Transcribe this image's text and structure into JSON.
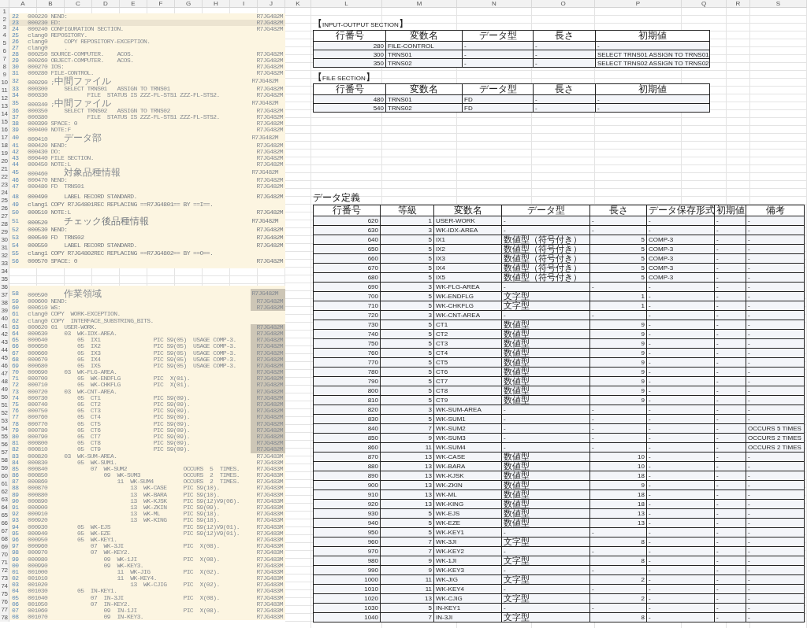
{
  "sheet": {
    "left_columns": [
      "A",
      "B",
      "C",
      "D",
      "E",
      "F",
      "G",
      "H",
      "I",
      "J"
    ],
    "right_columns": [
      "K",
      "L",
      "M",
      "N",
      "O",
      "P",
      "Q",
      "R",
      "S"
    ],
    "row_numbers": [
      "1",
      "2",
      "3",
      "4",
      "5",
      "6",
      "7",
      "8",
      "9",
      "10",
      "11",
      "12",
      "13",
      "14",
      "15",
      "16",
      "17",
      "18",
      "19",
      "20",
      "21",
      "22",
      "23",
      "24",
      "25",
      "26",
      "27",
      "28",
      "29",
      "30",
      "31",
      "32",
      "33",
      "34",
      "35",
      "36",
      "37",
      "38",
      "39",
      "40",
      "41",
      "42",
      "43",
      "44",
      "45",
      "46",
      "47",
      "48",
      "49",
      "50",
      "51",
      "52",
      "53",
      "54",
      "55",
      "56",
      "57",
      "58",
      "59",
      "60",
      "61",
      "62",
      "63",
      "64",
      "65",
      "66",
      "67",
      "68",
      "69",
      "70",
      "71",
      "72",
      "73",
      "74",
      "75",
      "76",
      "77",
      "78"
    ]
  },
  "code_top": [
    {
      "num": "22",
      "code": "000220 NEND:",
      "id": "R7JG482M",
      "kind": "code",
      "highlighted": false
    },
    {
      "num": "23",
      "code": "000230 ED:",
      "id": "R7JG482M",
      "kind": "code",
      "highlighted": true
    },
    {
      "num": "24",
      "code": "000240 CONFIGURATION SECTION.",
      "id": "R7JG482M",
      "kind": "code",
      "highlighted": false
    },
    {
      "num": "25",
      "code": "clang0 REPOSITORY.",
      "kind": "code",
      "highlighted": false
    },
    {
      "num": "26",
      "code": "clang0     COPY REPOSITORY-EXCEPTION.",
      "kind": "code",
      "highlighted": false
    },
    {
      "num": "27",
      "code": "clang0     .",
      "kind": "code",
      "highlighted": false
    },
    {
      "num": "28",
      "code": "000250 SOURCE-COMPUTER.    ACOS.",
      "id": "R7JG482M",
      "kind": "code",
      "highlighted": false
    },
    {
      "num": "29",
      "code": "000260 OBJECT-COMPUTER.    ACOS.",
      "id": "R7JG482M",
      "kind": "code",
      "highlighted": false
    },
    {
      "num": "30",
      "code": "000270 IOS:",
      "id": "R7JG482M",
      "kind": "code",
      "highlighted": false
    },
    {
      "num": "31",
      "code": "000280 FILE-CONTROL.",
      "id": "R7JG482M",
      "kind": "code",
      "highlighted": false
    },
    {
      "num": "32",
      "code": "000290 ;中間ファイル",
      "id": "R7JG482M",
      "kind": "note",
      "highlighted": false
    },
    {
      "num": "33",
      "code": "000300     SELECT TRNS01   ASSIGN TO TRNS01",
      "id": "R7JG482M",
      "kind": "code",
      "highlighted": false
    },
    {
      "num": "34",
      "code": "000330            FILE  STATUS IS ZZZ-FL-STS1 ZZZ-FL-STS2.",
      "id": "R7JG482M",
      "kind": "code",
      "highlighted": false
    },
    {
      "num": "35",
      "code": "000340 ;中間ファイル",
      "id": "R7JG482M",
      "kind": "note",
      "highlighted": false
    },
    {
      "num": "36",
      "code": "000350     SELECT TRNS02   ASSIGN TO TRNS02",
      "id": "R7JG482M",
      "kind": "code",
      "highlighted": false
    },
    {
      "num": "37",
      "code": "000380            FILE  STATUS IS ZZZ-FL-STS1 ZZZ-FL-STS2.",
      "id": "R7JG482M",
      "kind": "code",
      "highlighted": false
    },
    {
      "num": "38",
      "code": "000390 SPACE: 0",
      "id": "R7JG482M",
      "kind": "code",
      "highlighted": false
    },
    {
      "num": "39",
      "code": "000400 NOTE:F",
      "id": "R7JG482M",
      "kind": "code",
      "highlighted": false
    },
    {
      "num": "40",
      "code": "000410     データ部",
      "id": "R7JG482M",
      "kind": "note",
      "highlighted": false
    },
    {
      "num": "41",
      "code": "000420 NEND:",
      "id": "R7JG482M",
      "kind": "code",
      "highlighted": false
    },
    {
      "num": "42",
      "code": "000430 DO:",
      "id": "R7JG482M",
      "kind": "code",
      "highlighted": false
    },
    {
      "num": "43",
      "code": "000440 FILE SECTION.",
      "id": "R7JG482M",
      "kind": "code",
      "highlighted": false
    },
    {
      "num": "44",
      "code": "000450 NOTE:L",
      "id": "R7JG482M",
      "kind": "code",
      "highlighted": false
    },
    {
      "num": "45",
      "code": "000460     対象品種情報",
      "id": "R7JG482M",
      "kind": "note",
      "highlighted": false
    },
    {
      "num": "46",
      "code": "000470 NEND:",
      "id": "R7JG482M",
      "kind": "code",
      "highlighted": false
    },
    {
      "num": "47",
      "code": "000480 FD  TRNS01",
      "id": "R7JG482M",
      "kind": "code",
      "highlighted": false
    }
  ],
  "code_middle": [
    {
      "num": "48",
      "code": "000490     LABEL RECORD STANDARD.",
      "id": "R7JG482M",
      "kind": "code"
    },
    {
      "num": "49",
      "code": "clang1 COPY R7JG4801REC REPLACING ==R7JG4801== BY ==I==.",
      "kind": "code"
    },
    {
      "num": "50",
      "code": "000510 NOTE:L",
      "id": "R7JG482M",
      "kind": "code"
    },
    {
      "num": "51",
      "code": "000520     チェック後品種情報",
      "id": "R7JG482M",
      "kind": "note"
    },
    {
      "num": "52",
      "code": "000530 NEND:",
      "id": "R7JG482M",
      "kind": "code"
    },
    {
      "num": "53",
      "code": "000540 FD  TRNS02",
      "id": "R7JG482M",
      "kind": "code"
    },
    {
      "num": "54",
      "code": "000550     LABEL RECORD STANDARD.",
      "id": "R7JG482M",
      "kind": "code"
    },
    {
      "num": "55",
      "code": "clang1 COPY R7JG4802REC REPLACING ==R7JG4802== BY ==O==.",
      "kind": "code"
    },
    {
      "num": "56",
      "code": "000570 SPACE: 0",
      "id": "R7JG482M",
      "kind": "code"
    }
  ],
  "code_bottom": [
    {
      "num": "58",
      "code": "000590     作業領域",
      "id": "R7JG482M",
      "kind": "note",
      "id_selected": true
    },
    {
      "num": "59",
      "code": "000600 NEND:",
      "id": "R7JG482M",
      "kind": "code",
      "id_selected": true
    },
    {
      "num": "60",
      "code": "000610 WS:",
      "id": "R7JG482M",
      "kind": "code",
      "id_selected": true
    },
    {
      "num": "61",
      "code": "clang0 COPY  WORK-EXCEPTION.",
      "kind": "code"
    },
    {
      "num": "62",
      "code": "clang0 COPY  INTERFACE_SUBSTRING_BITS.",
      "kind": "code"
    },
    {
      "num": "63",
      "code": "000620 01  USER-WORK.",
      "id": "R7JG482M",
      "kind": "code",
      "id_selected": true
    },
    {
      "num": "64",
      "code": "000630     03  WK-IDX-AREA.",
      "id": "R7JG482M",
      "kind": "code",
      "id_selected": true
    },
    {
      "num": "65",
      "code": "000640         05  IX1                PIC S9(05)  USAGE COMP-3.",
      "id": "R7JG482M",
      "kind": "code",
      "id_selected": true
    },
    {
      "num": "66",
      "code": "000650         05  IX2                PIC S9(05)  USAGE COMP-3.",
      "id": "R7JG482M",
      "kind": "code",
      "id_selected": true
    },
    {
      "num": "67",
      "code": "000660         05  IX3                PIC S9(05)  USAGE COMP-3.",
      "id": "R7JG482M",
      "kind": "code",
      "id_selected": true
    },
    {
      "num": "68",
      "code": "000670         05  IX4                PIC S9(05)  USAGE COMP-3.",
      "id": "R7JG482M",
      "kind": "code",
      "id_selected": true
    },
    {
      "num": "69",
      "code": "000680         05  IX5                PIC S9(05)  USAGE COMP-3.",
      "id": "R7JG482M",
      "kind": "code",
      "id_selected": true
    },
    {
      "num": "70",
      "code": "000690     03  WK-FLG-AREA.",
      "id": "R7JG482M",
      "kind": "code",
      "id_selected": true
    },
    {
      "num": "71",
      "code": "000700         05  WK-ENDFLG          PIC  X(01).",
      "id": "R7JG482M",
      "kind": "code",
      "id_selected": true
    },
    {
      "num": "72",
      "code": "000710         05  WK-CHKFLG          PIC  X(01).",
      "id": "R7JG482M",
      "kind": "code",
      "id_selected": true
    },
    {
      "num": "73",
      "code": "000720     03  WK-CNT-AREA.",
      "id": "R7JG482M",
      "kind": "code",
      "id_selected": true
    },
    {
      "num": "74",
      "code": "000730         05  CT1                PIC S9(09).",
      "id": "R7JG482M",
      "kind": "code",
      "id_selected": true
    },
    {
      "num": "75",
      "code": "000740         05  CT2                PIC S9(09).",
      "id": "R7JG482M",
      "kind": "code",
      "id_selected": true
    },
    {
      "num": "76",
      "code": "000750         05  CT3                PIC S9(09).",
      "id": "R7JG482M",
      "kind": "code",
      "id_selected": true
    },
    {
      "num": "77",
      "code": "000760         05  CT4                PIC S9(09).",
      "id": "R7JG482M",
      "kind": "code",
      "id_selected": true
    },
    {
      "num": "78",
      "code": "000770         05  CT5                PIC S9(09).",
      "id": "R7JG482M",
      "kind": "code",
      "id_selected": true
    },
    {
      "num": "79",
      "code": "000780         05  CT6                PIC S9(09).",
      "id": "R7JG482M",
      "kind": "code",
      "id_selected": true
    },
    {
      "num": "80",
      "code": "000790         05  CT7                PIC S9(09).",
      "id": "R7JG482M",
      "kind": "code",
      "id_selected": true
    },
    {
      "num": "81",
      "code": "000800         05  CT8                PIC S9(09).",
      "id": "R7JG482M",
      "kind": "code",
      "id_selected": true
    },
    {
      "num": "82",
      "code": "000810         05  CT9                PIC S9(09).",
      "id": "R7JG482M",
      "kind": "code",
      "id_selected": true
    },
    {
      "num": "83",
      "code": "000820     03  WK-SUM-AREA.",
      "id": "R7JG483M",
      "kind": "code",
      "id_selected": false
    },
    {
      "num": "84",
      "code": "000830         05  WK-SUM1.",
      "id": "R7JG483M",
      "kind": "code",
      "id_selected": false
    },
    {
      "num": "85",
      "code": "000840             07  WK-SUM2                 OCCURS  5  TIMES.",
      "id": "R7JG483M",
      "kind": "code",
      "id_selected": false
    },
    {
      "num": "86",
      "code": "000850                 09  WK-SUM3             OCCURS  2  TIMES.",
      "id": "R7JG483M",
      "kind": "code",
      "id_selected": false
    },
    {
      "num": "87",
      "code": "000860                     11  WK-SUM4         OCCURS  2  TIMES.",
      "id": "R7JG483M",
      "kind": "code",
      "id_selected": false
    },
    {
      "num": "88",
      "code": "000870                         13  WK-CASE     PIC S9(10).",
      "id": "R7JG483M",
      "kind": "code",
      "id_selected": false
    },
    {
      "num": "89",
      "code": "000880                         13  WK-BARA     PIC S9(10).",
      "id": "R7JG483M",
      "kind": "code",
      "id_selected": false
    },
    {
      "num": "90",
      "code": "000890                         13  WK-KJSK     PIC S9(12)V9(06).",
      "id": "R7JG483M",
      "kind": "code",
      "id_selected": false
    },
    {
      "num": "91",
      "code": "000900                         13  WK-ZKIN     PIC S9(09).",
      "id": "R7JG483M",
      "kind": "code",
      "id_selected": false
    },
    {
      "num": "92",
      "code": "000910                         13  WK-ML       PIC S9(18).",
      "id": "R7JG483M",
      "kind": "code",
      "id_selected": false
    },
    {
      "num": "93",
      "code": "000920                         13  WK-KING     PIC S9(18).",
      "id": "R7JG483M",
      "kind": "code",
      "id_selected": false
    },
    {
      "num": "94",
      "code": "000930         05  WK-EJS                      PIC S9(12)V9(01).",
      "id": "R7JG483M",
      "kind": "code",
      "id_selected": false
    },
    {
      "num": "95",
      "code": "000940         05  WK-EZE                      PIC S9(12)V9(01).",
      "id": "R7JG483M",
      "kind": "code",
      "id_selected": false
    },
    {
      "num": "96",
      "code": "000950         05  WK-KEY1.",
      "id": "R7JG483M",
      "kind": "code",
      "id_selected": false
    },
    {
      "num": "97",
      "code": "000960             07  WK-3JI                  PIC  X(08).",
      "id": "R7JG483M",
      "kind": "code",
      "id_selected": false
    },
    {
      "num": "98",
      "code": "000970             07  WK-KEY2.",
      "id": "R7JG483M",
      "kind": "code",
      "id_selected": false
    },
    {
      "num": "99",
      "code": "000980                 09  WK-1JI              PIC  X(08).",
      "id": "R7JG483M",
      "kind": "code",
      "id_selected": false
    },
    {
      "num": "00",
      "code": "000990                 09  WK-KEY3.",
      "id": "R7JG483M",
      "kind": "code",
      "id_selected": false
    },
    {
      "num": "01",
      "code": "001000                     11  WK-JIG          PIC  X(02).",
      "id": "R7JG483M",
      "kind": "code",
      "id_selected": false
    },
    {
      "num": "02",
      "code": "001010                     11  WK-KEY4.",
      "id": "R7JG483M",
      "kind": "code",
      "id_selected": false
    },
    {
      "num": "03",
      "code": "001020                         13  WK-CJIG     PIC  X(02).",
      "id": "R7JG483M",
      "kind": "code",
      "id_selected": false
    },
    {
      "num": "04",
      "code": "001030         05  IN-KEY1.",
      "id": "R7JG483M",
      "kind": "code",
      "id_selected": false
    },
    {
      "num": "05",
      "code": "001040             07  IN-3JI                  PIC  X(08).",
      "id": "R7JG483M",
      "kind": "code",
      "id_selected": false
    },
    {
      "num": "06",
      "code": "001050             07  IN-KEY2.",
      "id": "R7JG483M",
      "kind": "code",
      "id_selected": false
    },
    {
      "num": "07",
      "code": "001060                 09  IN-1JI              PIC  X(08).",
      "id": "R7JG483M",
      "kind": "code",
      "id_selected": false
    },
    {
      "num": "08",
      "code": "001070                 09  IN-KEY3.",
      "id": "R7JG483M",
      "kind": "code",
      "id_selected": false
    }
  ],
  "io_section": {
    "title": "【INPUT-OUTPUT SECTION】",
    "columns": [
      "行番号",
      "変数名",
      "データ型",
      "長さ",
      "初期値"
    ],
    "rows": [
      [
        "280",
        "FILE-CONTROL",
        "-",
        "-",
        "-"
      ],
      [
        "300",
        "TRNS01",
        "-",
        "-",
        "SELECT TRNS01 ASSIGN TO TRNS01"
      ],
      [
        "350",
        "TRNS02",
        "-",
        "-",
        "SELECT TRNS02 ASSIGN TO TRNS02"
      ]
    ]
  },
  "file_section": {
    "title": "【FILE SECTION】",
    "columns": [
      "行番号",
      "変数名",
      "データ型",
      "長さ",
      "初期値"
    ],
    "rows": [
      [
        "480",
        "TRNS01",
        "FD",
        "-",
        "-"
      ],
      [
        "540",
        "TRNS02",
        "FD",
        "-",
        "-"
      ]
    ]
  },
  "data_definition": {
    "title": "データ定義",
    "columns": [
      "行番号",
      "等級",
      "変数名",
      "データ型",
      "長さ",
      "データ保存形式",
      "初期値",
      "備考"
    ],
    "rows": [
      {
        "kind": "group",
        "cells": [
          "620",
          "1",
          "USER-WORK",
          "-",
          "-",
          "-",
          "-",
          "-"
        ]
      },
      {
        "kind": "group",
        "cells": [
          "630",
          "3",
          "WK-IDX-AREA",
          "-",
          "-",
          "-",
          "-",
          "-"
        ]
      },
      {
        "kind": "item",
        "cells": [
          "640",
          "5",
          "IX1",
          "数値型（符号付き）",
          "5",
          "COMP-3",
          "-",
          "-"
        ]
      },
      {
        "kind": "item",
        "cells": [
          "650",
          "5",
          "IX2",
          "数値型（符号付き）",
          "5",
          "COMP-3",
          "-",
          "-"
        ]
      },
      {
        "kind": "item",
        "cells": [
          "660",
          "5",
          "IX3",
          "数値型（符号付き）",
          "5",
          "COMP-3",
          "-",
          "-"
        ]
      },
      {
        "kind": "item",
        "cells": [
          "670",
          "5",
          "IX4",
          "数値型（符号付き）",
          "5",
          "COMP-3",
          "-",
          "-"
        ]
      },
      {
        "kind": "item",
        "cells": [
          "680",
          "5",
          "IX5",
          "数値型（符号付き）",
          "5",
          "COMP-3",
          "-",
          "-"
        ]
      },
      {
        "kind": "group",
        "cells": [
          "690",
          "3",
          "WK-FLG-AREA",
          "-",
          "-",
          "-",
          "-",
          "-"
        ]
      },
      {
        "kind": "item",
        "cells": [
          "700",
          "5",
          "WK-ENDFLG",
          "文字型",
          "1",
          "-",
          "-",
          "-"
        ]
      },
      {
        "kind": "item",
        "cells": [
          "710",
          "5",
          "WK-CHKFLG",
          "文字型",
          "1",
          "-",
          "-",
          "-"
        ]
      },
      {
        "kind": "group",
        "cells": [
          "720",
          "3",
          "WK-CNT-AREA",
          "-",
          "-",
          "-",
          "-",
          "-"
        ]
      },
      {
        "kind": "item",
        "cells": [
          "730",
          "5",
          "CT1",
          "数値型",
          "9",
          "-",
          "-",
          "-"
        ]
      },
      {
        "kind": "item",
        "cells": [
          "740",
          "5",
          "CT2",
          "数値型",
          "9",
          "-",
          "-",
          "-"
        ]
      },
      {
        "kind": "item",
        "cells": [
          "750",
          "5",
          "CT3",
          "数値型",
          "9",
          "-",
          "-",
          "-"
        ]
      },
      {
        "kind": "item",
        "cells": [
          "760",
          "5",
          "CT4",
          "数値型",
          "9",
          "-",
          "-",
          "-"
        ]
      },
      {
        "kind": "item",
        "cells": [
          "770",
          "5",
          "CT5",
          "数値型",
          "9",
          "-",
          "-",
          "-"
        ]
      },
      {
        "kind": "item",
        "cells": [
          "780",
          "5",
          "CT6",
          "数値型",
          "9",
          "-",
          "-",
          "-"
        ]
      },
      {
        "kind": "item",
        "cells": [
          "790",
          "5",
          "CT7",
          "数値型",
          "9",
          "-",
          "-",
          "-"
        ]
      },
      {
        "kind": "item",
        "cells": [
          "800",
          "5",
          "CT8",
          "数値型",
          "9",
          "-",
          "-",
          "-"
        ]
      },
      {
        "kind": "item",
        "cells": [
          "810",
          "5",
          "CT9",
          "数値型",
          "9",
          "-",
          "-",
          "-"
        ]
      },
      {
        "kind": "group",
        "cells": [
          "820",
          "3",
          "WK-SUM-AREA",
          "-",
          "-",
          "-",
          "-",
          "-"
        ]
      },
      {
        "kind": "group",
        "cells": [
          "830",
          "5",
          "WK-SUM1",
          "-",
          "-",
          "-",
          "-",
          "-"
        ]
      },
      {
        "kind": "group",
        "cells": [
          "840",
          "7",
          "WK-SUM2",
          "-",
          "-",
          "-",
          "-",
          "OCCURS 5 TIMES"
        ]
      },
      {
        "kind": "group",
        "cells": [
          "850",
          "9",
          "WK-SUM3",
          "-",
          "-",
          "-",
          "-",
          "OCCURS 2 TIMES"
        ]
      },
      {
        "kind": "group",
        "cells": [
          "860",
          "11",
          "WK-SUM4",
          "-",
          "-",
          "-",
          "-",
          "OCCURS 2 TIMES"
        ]
      },
      {
        "kind": "item",
        "cells": [
          "870",
          "13",
          "WK-CASE",
          "数値型",
          "10",
          "-",
          "-",
          "-"
        ]
      },
      {
        "kind": "item",
        "cells": [
          "880",
          "13",
          "WK-BARA",
          "数値型",
          "10",
          "-",
          "-",
          "-"
        ]
      },
      {
        "kind": "item",
        "cells": [
          "890",
          "13",
          "WK-KJSK",
          "数値型",
          "18",
          "-",
          "-",
          "-"
        ]
      },
      {
        "kind": "item",
        "cells": [
          "900",
          "13",
          "WK-ZKIN",
          "数値型",
          "9",
          "-",
          "-",
          "-"
        ]
      },
      {
        "kind": "item",
        "cells": [
          "910",
          "13",
          "WK-ML",
          "数値型",
          "18",
          "-",
          "-",
          "-"
        ]
      },
      {
        "kind": "item",
        "cells": [
          "920",
          "13",
          "WK-KING",
          "数値型",
          "18",
          "-",
          "-",
          "-"
        ]
      },
      {
        "kind": "item",
        "cells": [
          "930",
          "5",
          "WK-EJS",
          "数値型",
          "13",
          "-",
          "-",
          "-"
        ]
      },
      {
        "kind": "item",
        "cells": [
          "940",
          "5",
          "WK-EZE",
          "数値型",
          "13",
          "-",
          "-",
          "-"
        ]
      },
      {
        "kind": "group",
        "cells": [
          "950",
          "5",
          "WK-KEY1",
          "-",
          "-",
          "-",
          "-",
          "-"
        ]
      },
      {
        "kind": "item",
        "cells": [
          "960",
          "7",
          "WK-3JI",
          "文字型",
          "8",
          "-",
          "-",
          "-"
        ]
      },
      {
        "kind": "group",
        "cells": [
          "970",
          "7",
          "WK-KEY2",
          "-",
          "-",
          "-",
          "-",
          "-"
        ]
      },
      {
        "kind": "item",
        "cells": [
          "980",
          "9",
          "WK-1JI",
          "文字型",
          "8",
          "-",
          "-",
          "-"
        ]
      },
      {
        "kind": "group",
        "cells": [
          "990",
          "9",
          "WK-KEY3",
          "-",
          "-",
          "-",
          "-",
          "-"
        ]
      },
      {
        "kind": "item",
        "cells": [
          "1000",
          "11",
          "WK-JIG",
          "文字型",
          "2",
          "-",
          "-",
          "-"
        ]
      },
      {
        "kind": "group",
        "cells": [
          "1010",
          "11",
          "WK-KEY4",
          "-",
          "-",
          "-",
          "-",
          "-"
        ]
      },
      {
        "kind": "item",
        "cells": [
          "1020",
          "13",
          "WK-CJIG",
          "文字型",
          "2",
          "-",
          "-",
          "-"
        ]
      },
      {
        "kind": "group",
        "cells": [
          "1030",
          "5",
          "IN-KEY1",
          "-",
          "-",
          "-",
          "-",
          "-"
        ]
      },
      {
        "kind": "item",
        "cells": [
          "1040",
          "7",
          "IN-3JI",
          "文字型",
          "8",
          "-",
          "-",
          "-"
        ]
      }
    ]
  }
}
